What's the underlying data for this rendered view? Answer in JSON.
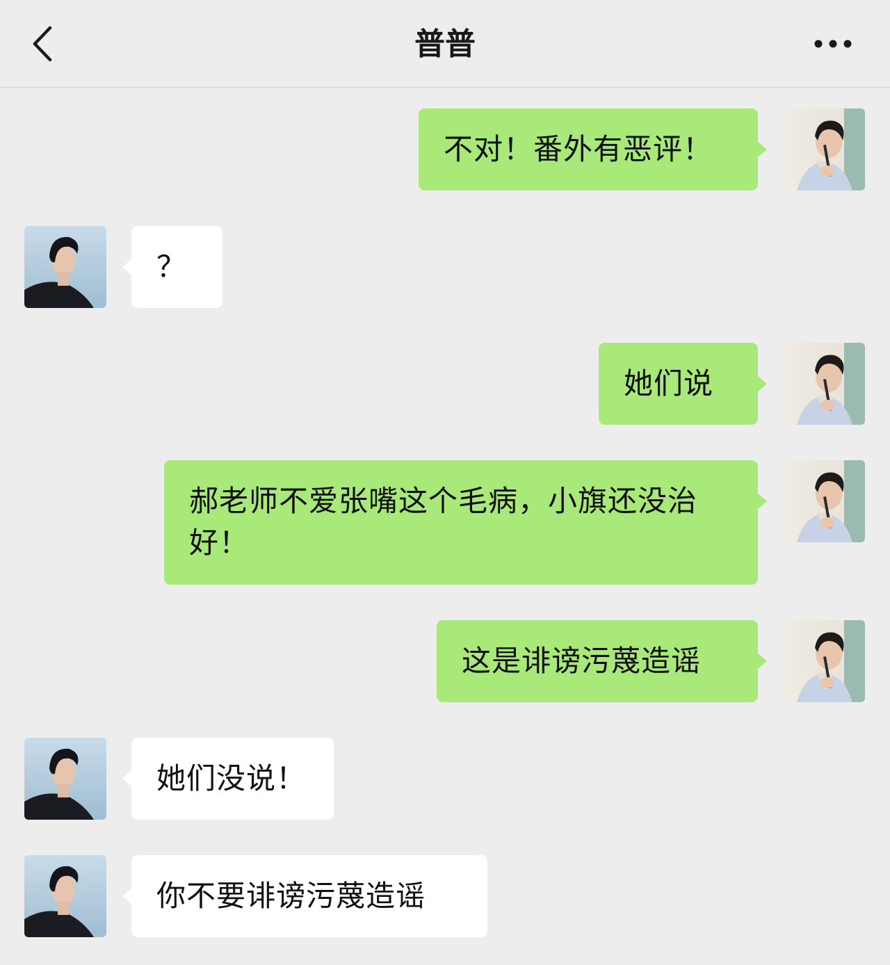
{
  "header": {
    "title": "普普",
    "back_icon": "chevron-left-icon",
    "more_icon": "more-dots-icon"
  },
  "messages": [
    {
      "sender": "me",
      "text": "不对！番外有恶评！"
    },
    {
      "sender": "them",
      "text": "？"
    },
    {
      "sender": "me",
      "text": "她们说"
    },
    {
      "sender": "me",
      "text": "郝老师不爱张嘴这个毛病，小旗还没治好！"
    },
    {
      "sender": "me",
      "text": "这是诽谤污蔑造谣"
    },
    {
      "sender": "them",
      "text": "她们没说！"
    },
    {
      "sender": "them",
      "text": "你不要诽谤污蔑造谣"
    }
  ],
  "colors": {
    "background": "#ededed",
    "sent_bubble": "#a9e97a",
    "received_bubble": "#ffffff",
    "text": "#111111"
  }
}
